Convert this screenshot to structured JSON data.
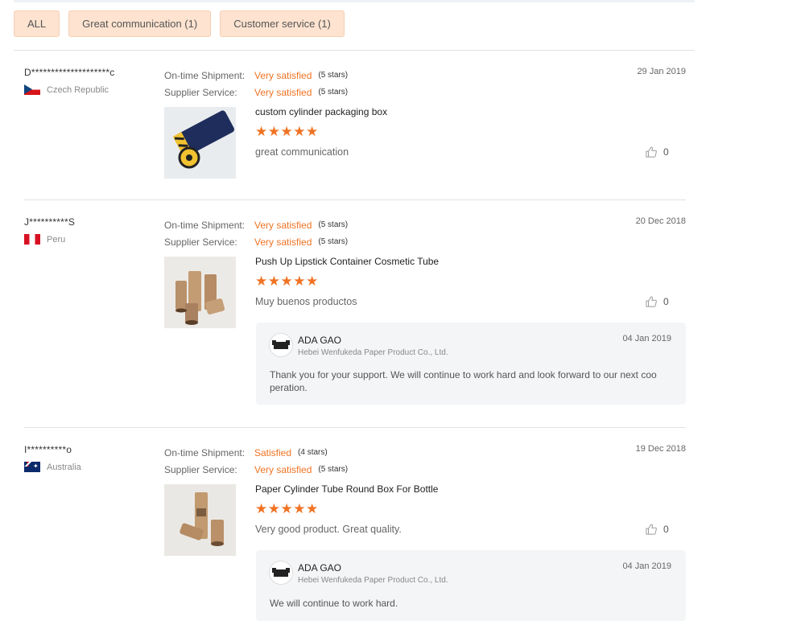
{
  "filters": [
    {
      "label": "ALL"
    },
    {
      "label": "Great communication (1)"
    },
    {
      "label": "Customer service (1)"
    }
  ],
  "rating_labels": {
    "shipment": "On-time Shipment:",
    "service": "Supplier Service:"
  },
  "reviews": [
    {
      "buyer": "D********************c",
      "country": "Czech Republic",
      "date": "29 Jan 2019",
      "shipment_value": "Very satisfied",
      "shipment_stars": "(5 stars)",
      "service_value": "Very satisfied",
      "service_stars": "(5 stars)",
      "product": "custom cylinder packaging box",
      "stars": "★★★★★",
      "comment": "great communication",
      "likes": "0"
    },
    {
      "buyer": "J**********S",
      "country": "Peru",
      "date": "20 Dec 2018",
      "shipment_value": "Very satisfied",
      "shipment_stars": "(5 stars)",
      "service_value": "Very satisfied",
      "service_stars": "(5 stars)",
      "product": "Push Up Lipstick Container Cosmetic Tube",
      "stars": "★★★★★",
      "comment": "Muy buenos productos",
      "likes": "0",
      "reply": {
        "name": "ADA GAO",
        "company": "Hebei Wenfukeda Paper Product Co., Ltd.",
        "date": "04 Jan 2019",
        "text": "Thank you for your support. We will continue to work hard and look forward to our next coo peration."
      }
    },
    {
      "buyer": "I**********o",
      "country": "Australia",
      "date": "19 Dec 2018",
      "shipment_value": "Satisfied",
      "shipment_stars": "(4 stars)",
      "service_value": "Very satisfied",
      "service_stars": "(5 stars)",
      "product": "Paper Cylinder Tube Round Box For Bottle",
      "stars": "★★★★★",
      "comment": "Very good product. Great quality.",
      "likes": "0",
      "reply": {
        "name": "ADA GAO",
        "company": "Hebei Wenfukeda Paper Product Co., Ltd.",
        "date": "04 Jan 2019",
        "text": "We will continue to work hard."
      }
    }
  ],
  "colors": {
    "accent": "#f07323",
    "filter_bg": "#fde3d0",
    "reply_bg": "#f4f5f7"
  },
  "icons": {
    "like": "thumbs-up-icon",
    "avatar": "supplier-logo-icon"
  }
}
